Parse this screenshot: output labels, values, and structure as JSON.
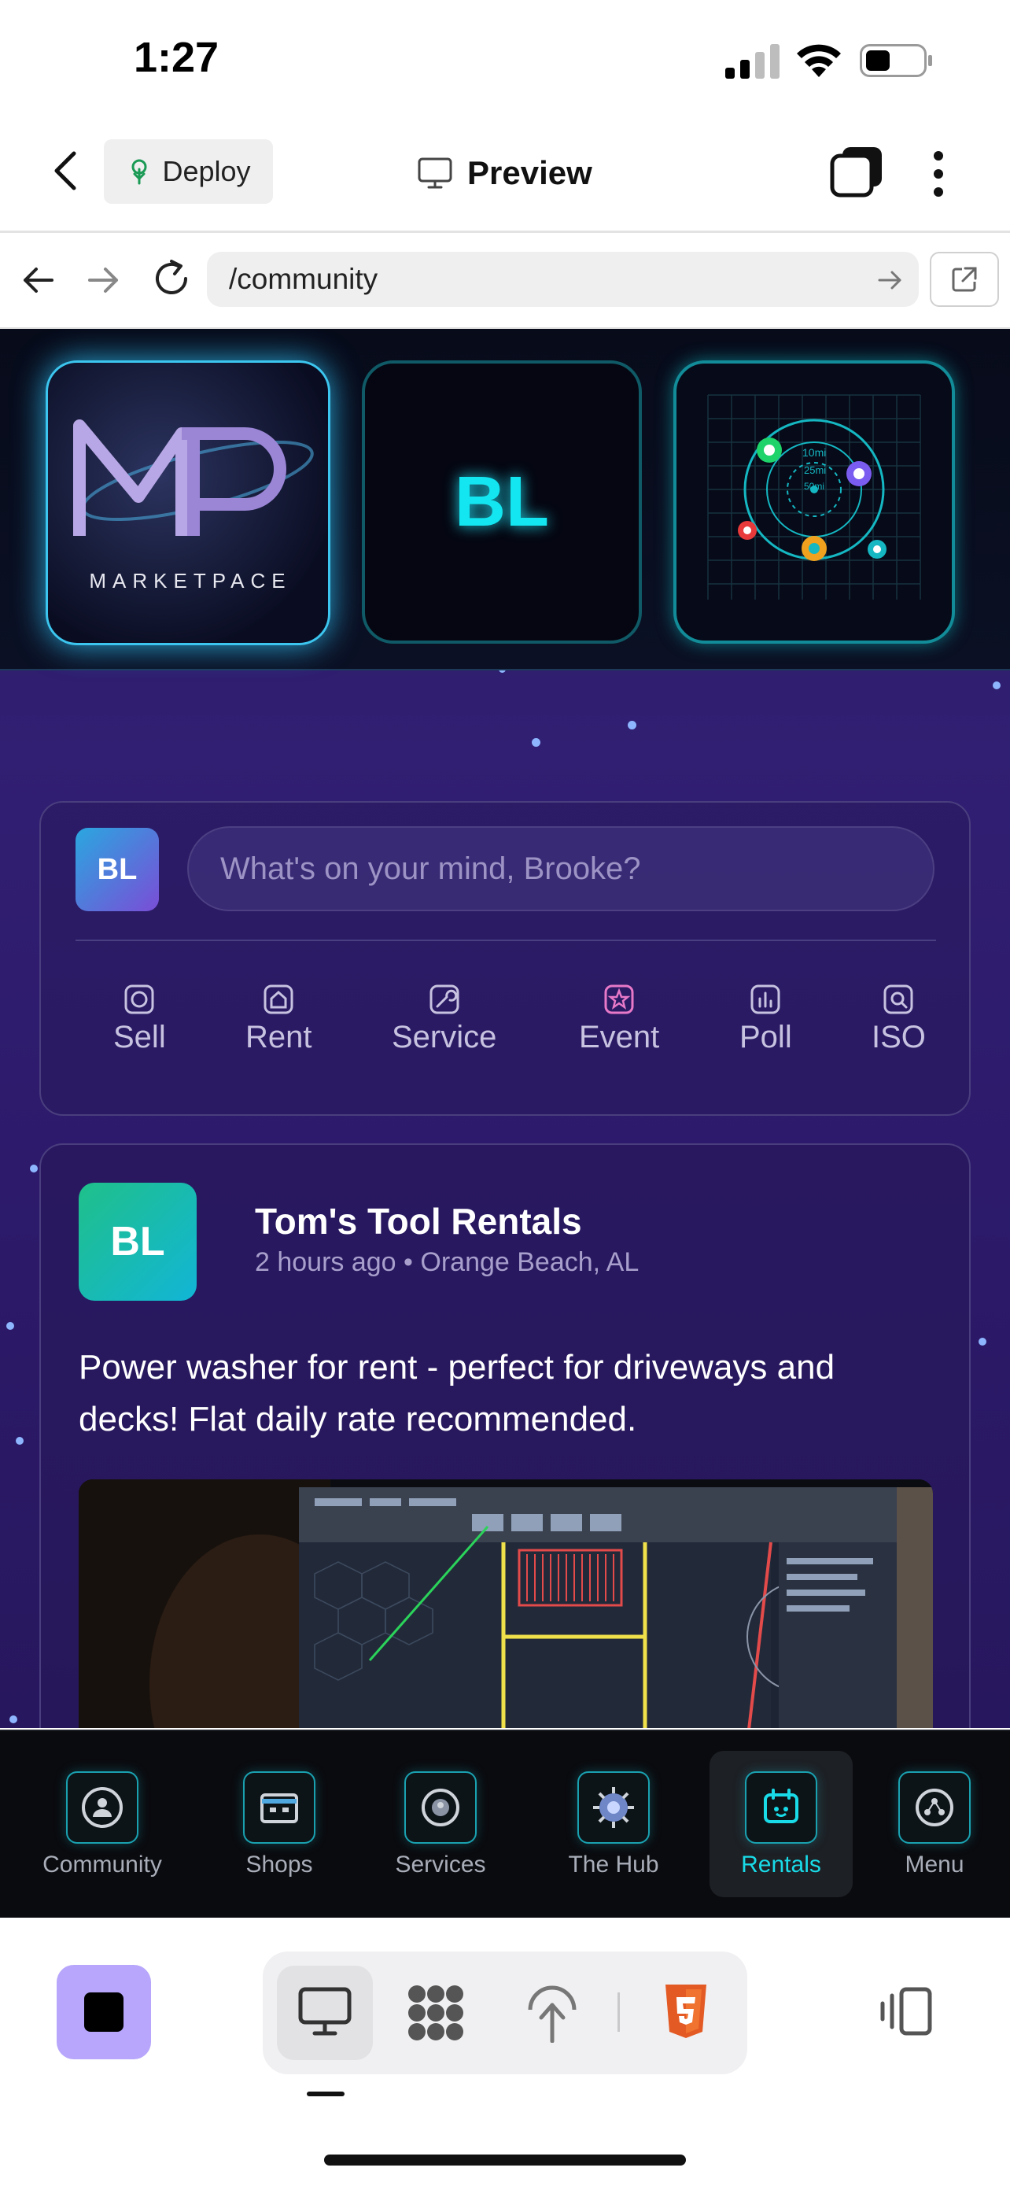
{
  "status_bar": {
    "time": "1:27"
  },
  "top_bar": {
    "deploy_label": "Deploy",
    "preview_label": "Preview"
  },
  "browser": {
    "url": "/community"
  },
  "hero": {
    "logo_text": "MARKETPACE",
    "initials_tile": "BL",
    "map_labels": [
      "10mi",
      "25mi",
      "50mi"
    ]
  },
  "composer": {
    "avatar": "BL",
    "placeholder": "What's on your mind, Brooke?",
    "actions": [
      {
        "label": "Sell",
        "icon": "tag-icon"
      },
      {
        "label": "Rent",
        "icon": "house-icon"
      },
      {
        "label": "Service",
        "icon": "wrench-icon"
      },
      {
        "label": "Event",
        "icon": "star-icon"
      },
      {
        "label": "Poll",
        "icon": "poll-icon"
      },
      {
        "label": "ISO",
        "icon": "search-icon"
      }
    ]
  },
  "post": {
    "avatar": "BL",
    "author": "Tom's Tool Rentals",
    "time": "2 hours ago",
    "location": "Orange Beach, AL",
    "body": "Power washer for rent - perfect for driveways and decks! Flat daily rate recommended."
  },
  "tabbar": {
    "tabs": [
      {
        "label": "Community",
        "icon": "community-icon"
      },
      {
        "label": "Shops",
        "icon": "shop-icon"
      },
      {
        "label": "Services",
        "icon": "services-icon"
      },
      {
        "label": "The Hub",
        "icon": "hub-icon"
      },
      {
        "label": "Rentals",
        "icon": "rentals-icon",
        "active": true
      },
      {
        "label": "Menu",
        "icon": "menu-icon"
      }
    ]
  },
  "colors": {
    "accent": "#19dbe8",
    "composer_bg": "#2d1a6b",
    "stop_button": "#b7a6fb"
  }
}
